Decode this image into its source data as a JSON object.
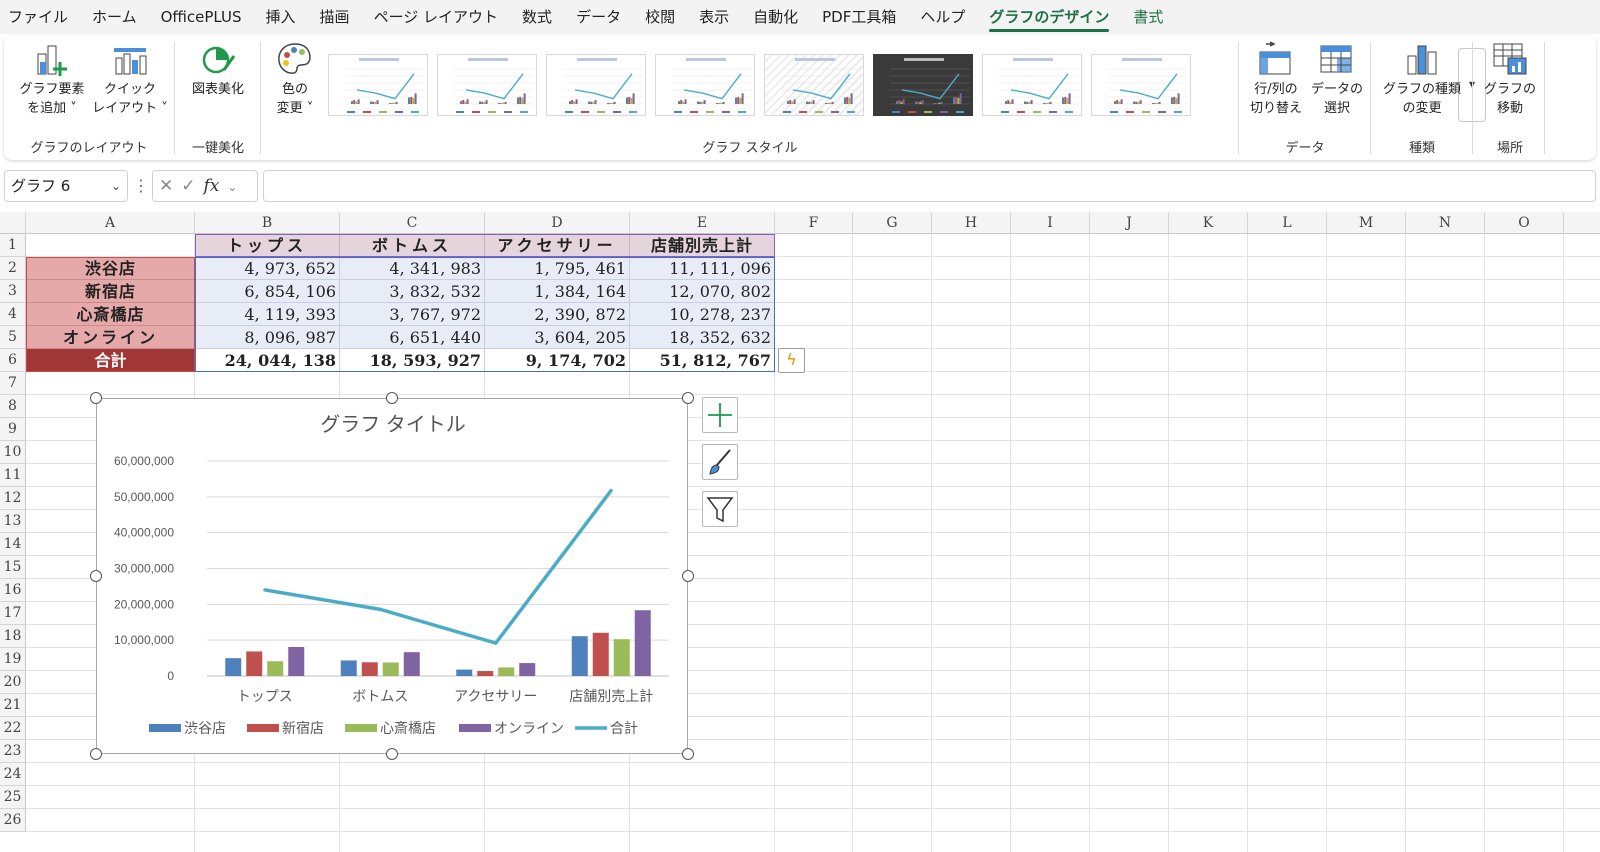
{
  "menu": {
    "tabs": [
      "ファイル",
      "ホーム",
      "OfficePLUS",
      "挿入",
      "描画",
      "ページ レイアウト",
      "数式",
      "データ",
      "校閲",
      "表示",
      "自動化",
      "PDF工具箱",
      "ヘルプ",
      "グラフのデザイン",
      "書式"
    ],
    "active_tab": "グラフのデザイン"
  },
  "ribbon": {
    "add_element": {
      "line1": "グラフ要素",
      "line2": "を追加 ˅"
    },
    "quick_layout": {
      "line1": "クイック",
      "line2": "レイアウト ˅"
    },
    "group_layout": "グラフのレイアウト",
    "beautify": {
      "line1": "図表美化"
    },
    "group_beautify": "一键美化",
    "color_change": {
      "line1": "色の",
      "line2": "変更 ˅"
    },
    "group_style": "グラフ スタイル",
    "switch_rowcol": {
      "line1": "行/列の",
      "line2": "切り替え"
    },
    "select_data": {
      "line1": "データの",
      "line2": "選択"
    },
    "group_data": "データ",
    "change_type": {
      "line1": "グラフの種類",
      "line2": "の変更"
    },
    "group_type": "種類",
    "move_chart": {
      "line1": "グラフの",
      "line2": "移動"
    },
    "group_location": "場所",
    "gallery_expand_icon": "chevron-down-icon"
  },
  "formula_bar": {
    "name_box": "グラフ 6",
    "formula": ""
  },
  "columns": [
    "A",
    "B",
    "C",
    "D",
    "E",
    "F",
    "G",
    "H",
    "I",
    "J",
    "K",
    "L",
    "M",
    "N",
    "O"
  ],
  "rows": [
    "1",
    "2",
    "3",
    "4",
    "5",
    "6",
    "7",
    "8",
    "9",
    "10",
    "11",
    "12",
    "13",
    "14",
    "15",
    "16",
    "17",
    "18",
    "19",
    "20",
    "21",
    "22",
    "23",
    "24",
    "25",
    "26"
  ],
  "table": {
    "headers": [
      "トップス",
      "ボトムス",
      "アクセサリー",
      "店舗別売上計"
    ],
    "rows": [
      {
        "label": "渋谷店",
        "values": [
          "4, 973, 652",
          "4, 341, 983",
          "1, 795, 461",
          "11, 111, 096"
        ]
      },
      {
        "label": "新宿店",
        "values": [
          "6, 854, 106",
          "3, 832, 532",
          "1, 384, 164",
          "12, 070, 802"
        ]
      },
      {
        "label": "心斎橋店",
        "values": [
          "4, 119, 393",
          "3, 767, 972",
          "2, 390, 872",
          "10, 278, 237"
        ]
      },
      {
        "label": "オンライン",
        "values": [
          "8, 096, 987",
          "6, 651, 440",
          "3, 604, 205",
          "18, 352, 632"
        ]
      }
    ],
    "total": {
      "label": "合計",
      "values": [
        "24, 044, 138",
        "18, 593, 927",
        "9, 174, 702",
        "51, 812, 767"
      ]
    }
  },
  "chart_data": {
    "type": "bar",
    "title": "グラフ タイトル",
    "categories": [
      "トップス",
      "ボトムス",
      "アクセサリー",
      "店舗別売上計"
    ],
    "series": [
      {
        "name": "渋谷店",
        "type": "bar",
        "color": "#4f81bd",
        "values": [
          4973652,
          4341983,
          1795461,
          11111096
        ]
      },
      {
        "name": "新宿店",
        "type": "bar",
        "color": "#c0504d",
        "values": [
          6854106,
          3832532,
          1384164,
          12070802
        ]
      },
      {
        "name": "心斎橋店",
        "type": "bar",
        "color": "#9bbb59",
        "values": [
          4119393,
          3767972,
          2390872,
          10278237
        ]
      },
      {
        "name": "オンライン",
        "type": "bar",
        "color": "#8064a2",
        "values": [
          8096987,
          6651440,
          3604205,
          18352632
        ]
      },
      {
        "name": "合計",
        "type": "line",
        "color": "#4bacc6",
        "values": [
          24044138,
          18593927,
          9174702,
          51812767
        ]
      }
    ],
    "y_ticks": [
      "0",
      "10,000,000",
      "20,000,000",
      "30,000,000",
      "40,000,000",
      "50,000,000",
      "60,000,000"
    ],
    "ylim": [
      0,
      60000000
    ],
    "grid": true,
    "legend": "bottom"
  }
}
